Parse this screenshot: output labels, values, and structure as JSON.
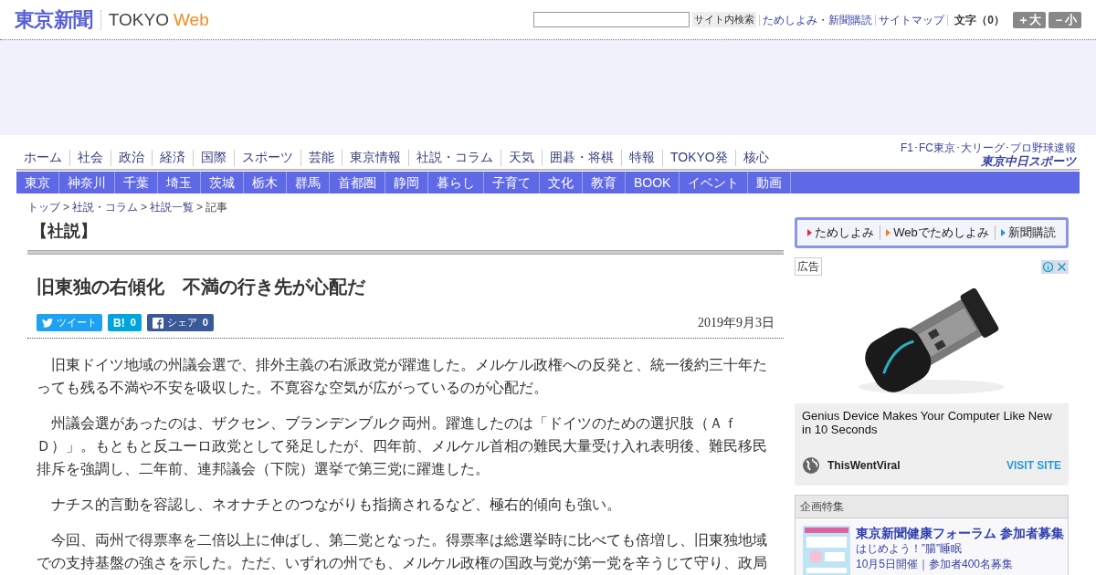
{
  "header": {
    "logo": "東京新聞",
    "brand_main": "TOKYO",
    "brand_accent": "Web",
    "search_button": "サイト内検索",
    "links": [
      "ためしよみ・新聞購読",
      "サイトマップ"
    ],
    "font_size_label": "文字（0）",
    "font_buttons": [
      "＋大",
      "－小"
    ]
  },
  "nav_main": [
    "ホーム",
    "社会",
    "政治",
    "経済",
    "国際",
    "スポーツ",
    "芸能",
    "東京情報",
    "社説・コラム",
    "天気",
    "囲碁・将棋",
    "特報",
    "TOKYO発",
    "核心"
  ],
  "sports_promo": {
    "caption": "F1･FC東京･大リーグ･プロ野球速報",
    "name": "東京中日スポーツ"
  },
  "nav_regional": [
    "東京",
    "神奈川",
    "千葉",
    "埼玉",
    "茨城",
    "栃木",
    "群馬",
    "首都圏",
    "静岡",
    "暮らし",
    "子育て",
    "文化",
    "教育",
    "BOOK",
    "イベント",
    "動画"
  ],
  "breadcrumb_separator": ">",
  "breadcrumb": [
    {
      "label": "トップ",
      "link": true
    },
    {
      "label": "社説・コラム",
      "link": true
    },
    {
      "label": "社説一覧",
      "link": true
    },
    {
      "label": "記事",
      "link": false
    }
  ],
  "article": {
    "section": "【社説】",
    "title": "旧東独の右傾化　不満の行き先が心配だ",
    "share_buttons": [
      {
        "kind": "twitter",
        "label": "ツイート"
      },
      {
        "kind": "hatena",
        "label": "B!",
        "count": "0"
      },
      {
        "kind": "facebook",
        "label": "シェア",
        "count": "0"
      }
    ],
    "date": "2019年9月3日",
    "paragraphs": [
      "旧東ドイツ地域の州議会選で、排外主義の右派政党が躍進した。メルケル政権への反発と、統一後約三十年たっても残る不満や不安を吸収した。不寛容な空気が広がっているのが心配だ。",
      "州議会選があったのは、ザクセン、ブランデンブルク両州。躍進したのは「ドイツのための選択肢（ＡｆＤ）」。もともと反ユーロ政党として発足したが、四年前、メルケル首相の難民大量受け入れ表明後、難民移民排斥を強調し、二年前、連邦議会（下院）選挙で第三党に躍進した。",
      "ナチス的言動を容認し、ネオナチとのつながりも指摘されるなど、極右的傾向も強い。",
      "今回、両州で得票率を二倍以上に伸ばし、第二党となった。得票率は総選挙時に比べても倍増し、旧東独地域での支持基盤の強さを示した。ただ、いずれの州でも、メルケル政権の国政与党が第一党を辛うじて守り、政局"
    ]
  },
  "sidebar": {
    "subscribe_links": [
      {
        "label": "ためしよみ",
        "color": "#e03030"
      },
      {
        "label": "Webでためしよみ",
        "color": "#f08020"
      },
      {
        "label": "新聞購読",
        "color": "#3090e0"
      }
    ],
    "ad": {
      "label": "広告",
      "headline": "Genius Device Makes Your Computer Like New in 10 Seconds",
      "advertiser": "ThisWentViral",
      "cta": "VISIT SITE"
    },
    "feature": {
      "heading": "企画特集",
      "title": "東京新聞健康フォーラム 参加者募集",
      "lines": [
        "はじめよう！”腸”睡眠",
        "10月5日開催｜参加者400名募集"
      ]
    }
  }
}
